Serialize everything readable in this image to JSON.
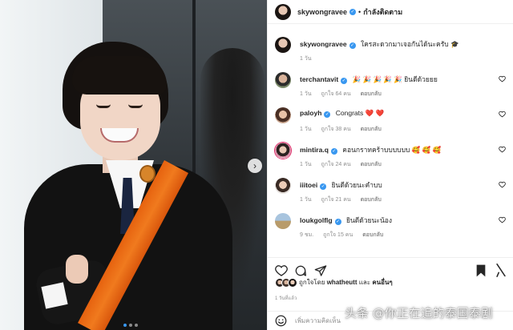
{
  "post": {
    "username": "skywongravee",
    "separator": "•",
    "follow_status": "กำลังติดตาม",
    "photo_dots": 3,
    "photo_active_index": 0
  },
  "caption": {
    "username": "skywongravee",
    "text": "ใครสะดวกมาเจอกันได้นะครับ 🎓",
    "time": "1 วัน"
  },
  "comments": [
    {
      "username": "terchantavit",
      "text": "🎉 🎉 🎉 🎉 🎉 ยินดีด้วยยย",
      "time": "1 วัน",
      "likes": "ถูกใจ 64 คน",
      "reply": "ตอบกลับ"
    },
    {
      "username": "paloyh",
      "text": "Congrats ❤️ ❤️",
      "time": "1 วัน",
      "likes": "ถูกใจ 38 คน",
      "reply": "ตอบกลับ"
    },
    {
      "username": "mintira.q",
      "text": "คอนกราทคร้าบบบบบบ 🥰 🥰 🥰",
      "time": "1 วัน",
      "likes": "ถูกใจ 24 คน",
      "reply": "ตอบกลับ"
    },
    {
      "username": "iiitoei",
      "text": "ยินดีด้วยนะคำบบ",
      "time": "1 วัน",
      "likes": "ถูกใจ 21 คน",
      "reply": "ตอบกลับ"
    },
    {
      "username": "loukgolflg",
      "text": "ยินดีด้วยนะน้อง",
      "time": "9 ชม.",
      "likes": "ถูกใจ 15 คน",
      "reply": "ตอบกลับ"
    }
  ],
  "likes_line": {
    "prefix": "ถูกใจโดย",
    "user": "whatheutt",
    "joiner": "และ",
    "others": "คนอื่นๆ"
  },
  "date": "1 วันที่แล้ว",
  "add_comment": {
    "placeholder": "เพิ่มความคิดเห็น"
  },
  "watermark": "头条 @你正在追的泰国泰剧",
  "colors": {
    "accent": "#3897f0",
    "text": "#262626",
    "muted": "#8e8e8e",
    "divider": "#efefef",
    "sash": "#f07a1e"
  },
  "icons": {
    "next": "chevron-right-icon",
    "like": "heart-icon",
    "comment": "comment-icon",
    "share": "paper-plane-icon",
    "save": "bookmark-icon",
    "emoji": "smile-icon",
    "verified": "verified-badge-icon"
  }
}
